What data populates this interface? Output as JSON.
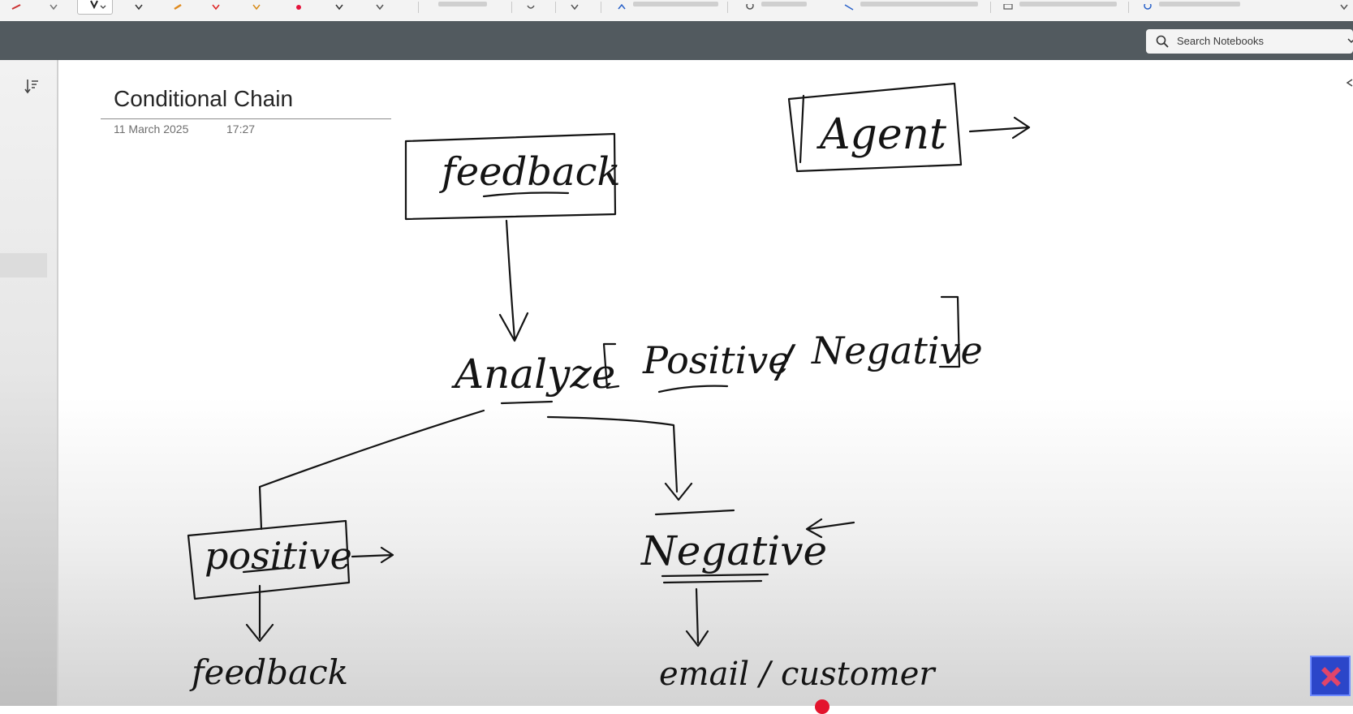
{
  "toolbar": {
    "pen_dropdown_icon": "pen-dropdown-icon"
  },
  "search": {
    "placeholder": "Search Notebooks",
    "icon": "search-icon"
  },
  "page": {
    "title": "Conditional Chain",
    "date": "11 March 2025",
    "time": "17:27"
  },
  "ink": {
    "feedback_box": "feedback",
    "agent_box": "Agent",
    "analyze": "Analyze",
    "positive_option": "Positive",
    "slash": "/",
    "negative_option": "Negative",
    "positive_box": "positive",
    "negative_label": "Negative",
    "feedback_lower": "feedback",
    "email_customer": "email / customer"
  },
  "colors": {
    "top_bar": "#525a5f",
    "ink": "#141414",
    "canvas": "#ffffff",
    "recording_dot": "#e3142d",
    "app_icon": "#2b46c9"
  }
}
